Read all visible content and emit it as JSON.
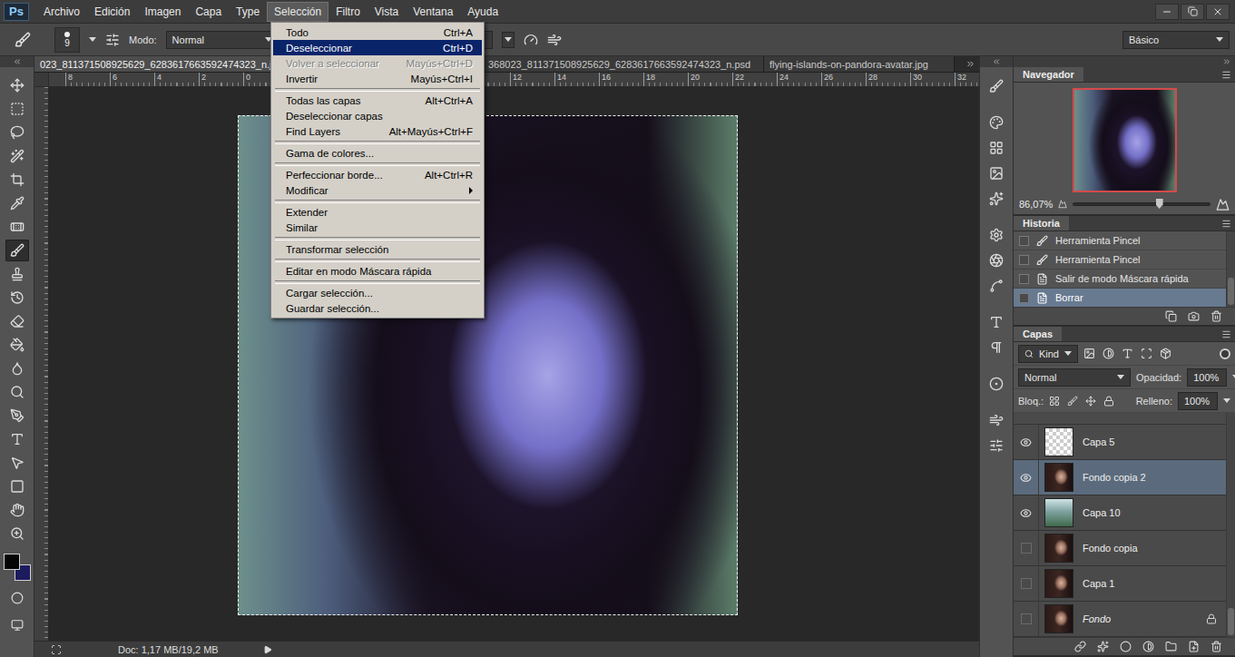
{
  "app": {
    "logo": "Ps"
  },
  "menubar": [
    {
      "label": "Archivo",
      "selected": false
    },
    {
      "label": "Edición",
      "selected": false
    },
    {
      "label": "Imagen",
      "selected": false
    },
    {
      "label": "Capa",
      "selected": false
    },
    {
      "label": "Type",
      "selected": false
    },
    {
      "label": "Selección",
      "selected": true
    },
    {
      "label": "Filtro",
      "selected": false
    },
    {
      "label": "Vista",
      "selected": false
    },
    {
      "label": "Ventana",
      "selected": false
    },
    {
      "label": "Ayuda",
      "selected": false
    }
  ],
  "options_bar": {
    "brush_size": "9",
    "mode_label": "Modo:",
    "mode_value": "Normal",
    "opacity_unit": "%",
    "workspace": "Básico"
  },
  "doc_tabs": [
    {
      "label": "023_811371508925629_6283617663592474323_n.jp",
      "selected": true
    },
    {
      "label": "368023_811371508925629_6283617663592474323_n.psd",
      "selected": false
    },
    {
      "label": "flying-islands-on-pandora-avatar.jpg",
      "selected": false
    }
  ],
  "ruler": {
    "left_labels": [
      "8",
      "6",
      "4",
      "2",
      "0"
    ],
    "right_labels": [
      "12",
      "14",
      "16",
      "18",
      "20",
      "22",
      "24",
      "26",
      "28",
      "30",
      "32"
    ]
  },
  "tools": [
    {
      "selected": false
    },
    {
      "selected": false
    },
    {
      "selected": false
    },
    {
      "selected": false
    },
    {
      "selected": false
    },
    {
      "selected": false
    },
    {
      "selected": false
    },
    {
      "selected": true
    },
    {
      "selected": false
    },
    {
      "selected": false
    },
    {
      "selected": false
    },
    {
      "selected": false
    },
    {
      "selected": false
    },
    {
      "selected": false
    },
    {
      "selected": false
    },
    {
      "selected": false
    },
    {
      "selected": false
    },
    {
      "selected": false
    },
    {
      "selected": false
    },
    {
      "selected": false
    }
  ],
  "tool_colors": {
    "foreground": "#050505",
    "background": "#1c1b5e"
  },
  "open_menu": {
    "items": [
      {
        "kind": "item",
        "label": "Todo",
        "shortcut": "Ctrl+A",
        "selected": false,
        "disabled": false,
        "submenu": false
      },
      {
        "kind": "item",
        "label": "Deseleccionar",
        "shortcut": "Ctrl+D",
        "selected": true,
        "disabled": false,
        "submenu": false
      },
      {
        "kind": "item",
        "label": "Volver a seleccionar",
        "shortcut": "Mayús+Ctrl+D",
        "selected": false,
        "disabled": true,
        "submenu": false
      },
      {
        "kind": "item",
        "label": "Invertir",
        "shortcut": "Mayús+Ctrl+I",
        "selected": false,
        "disabled": false,
        "submenu": false
      },
      {
        "kind": "separator"
      },
      {
        "kind": "item",
        "label": "Todas las capas",
        "shortcut": "Alt+Ctrl+A",
        "selected": false,
        "disabled": false,
        "submenu": false
      },
      {
        "kind": "item",
        "label": "Deseleccionar capas",
        "shortcut": "",
        "selected": false,
        "disabled": false,
        "submenu": false
      },
      {
        "kind": "item",
        "label": "Find Layers",
        "shortcut": "Alt+Mayús+Ctrl+F",
        "selected": false,
        "disabled": false,
        "submenu": false
      },
      {
        "kind": "separator"
      },
      {
        "kind": "item",
        "label": "Gama de colores...",
        "shortcut": "",
        "selected": false,
        "disabled": false,
        "submenu": false
      },
      {
        "kind": "separator"
      },
      {
        "kind": "item",
        "label": "Perfeccionar borde...",
        "shortcut": "Alt+Ctrl+R",
        "selected": false,
        "disabled": false,
        "submenu": false
      },
      {
        "kind": "item",
        "label": "Modificar",
        "shortcut": "",
        "selected": false,
        "disabled": false,
        "submenu": true
      },
      {
        "kind": "separator"
      },
      {
        "kind": "item",
        "label": "Extender",
        "shortcut": "",
        "selected": false,
        "disabled": false,
        "submenu": false
      },
      {
        "kind": "item",
        "label": "Similar",
        "shortcut": "",
        "selected": false,
        "disabled": false,
        "submenu": false
      },
      {
        "kind": "separator"
      },
      {
        "kind": "item",
        "label": "Transformar selección",
        "shortcut": "",
        "selected": false,
        "disabled": false,
        "submenu": false
      },
      {
        "kind": "separator"
      },
      {
        "kind": "item",
        "label": "Editar en modo Máscara rápida",
        "shortcut": "",
        "selected": false,
        "disabled": false,
        "submenu": false
      },
      {
        "kind": "separator"
      },
      {
        "kind": "item",
        "label": "Cargar selección...",
        "shortcut": "",
        "selected": false,
        "disabled": false,
        "submenu": false
      },
      {
        "kind": "item",
        "label": "Guardar selección...",
        "shortcut": "",
        "selected": false,
        "disabled": false,
        "submenu": false
      }
    ]
  },
  "navigator": {
    "title": "Navegador",
    "zoom": "86,07%",
    "level": 0.63
  },
  "history": {
    "title": "Historia",
    "steps": [
      {
        "label": "Herramienta Pincel",
        "kind": "brush",
        "selected": false
      },
      {
        "label": "Herramienta Pincel",
        "kind": "brush",
        "selected": false
      },
      {
        "label": "Salir de modo Máscara rápida",
        "kind": "step",
        "selected": false
      },
      {
        "label": "Borrar",
        "kind": "step",
        "selected": true
      }
    ]
  },
  "layers": {
    "title": "Capas",
    "filter": "Kind",
    "blend_mode": "Normal",
    "opacity_label": "Opacidad:",
    "opacity": "100%",
    "lock_label": "Bloq.:",
    "fill_label": "Relleno:",
    "fill": "100%",
    "items": [
      {
        "name": "Capa 5",
        "visible": true,
        "selected": false,
        "thumb": "transparent",
        "locked": false,
        "background": false
      },
      {
        "name": "Fondo copia 2",
        "visible": true,
        "selected": true,
        "thumb": "portrait",
        "locked": false,
        "background": false
      },
      {
        "name": "Capa 10",
        "visible": true,
        "selected": false,
        "thumb": "landscape",
        "locked": false,
        "background": false
      },
      {
        "name": "Fondo copia",
        "visible": false,
        "selected": false,
        "thumb": "portrait",
        "locked": false,
        "background": false
      },
      {
        "name": "Capa 1",
        "visible": false,
        "selected": false,
        "thumb": "portrait",
        "locked": false,
        "background": false
      },
      {
        "name": "Fondo",
        "visible": false,
        "selected": false,
        "thumb": "portrait",
        "locked": true,
        "background": true
      }
    ]
  },
  "status_bar": {
    "doc": "Doc: 1,17 MB/19,2 MB"
  }
}
